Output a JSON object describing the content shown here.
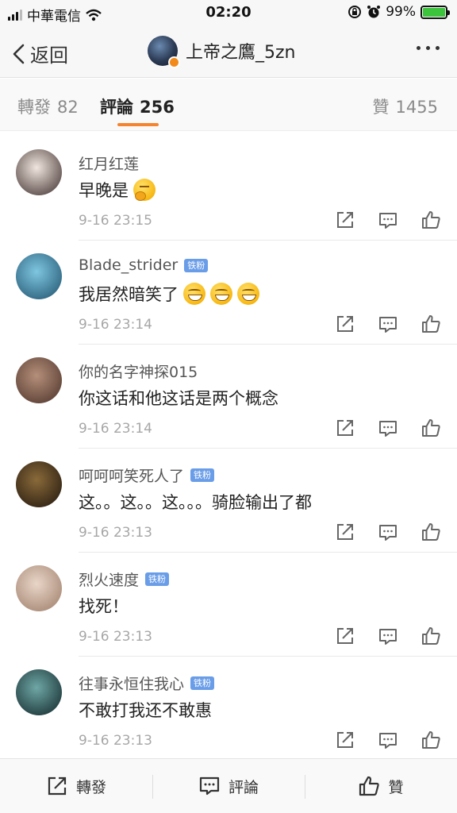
{
  "status_bar": {
    "carrier": "中華電信",
    "time": "02:20",
    "battery": "99%"
  },
  "nav": {
    "back_label": "返回",
    "title": "上帝之鷹_5zn"
  },
  "tabs": [
    {
      "label": "轉發",
      "count": "82"
    },
    {
      "label": "評論",
      "count": "256"
    },
    {
      "label": "贊",
      "count": "1455"
    }
  ],
  "comments": [
    {
      "name": "红月红莲",
      "badge": "",
      "text": "早晚是",
      "emojis": [
        "think"
      ],
      "time": "9-16 23:15",
      "avatar_colors": [
        "#f0e6df",
        "#3a2a28"
      ]
    },
    {
      "name": "Blade_strider",
      "badge": "铁粉",
      "text": "我居然暗笑了",
      "emojis": [
        "grin",
        "grin",
        "grin"
      ],
      "time": "9-16 23:14",
      "avatar_colors": [
        "#7fc6e0",
        "#1d4f6a"
      ]
    },
    {
      "name": "你的名字神探015",
      "badge": "",
      "text": "你这话和他这话是两个概念",
      "emojis": [],
      "time": "9-16 23:14",
      "avatar_colors": [
        "#b58f7a",
        "#4a3128"
      ]
    },
    {
      "name": "呵呵呵笑死人了",
      "badge": "铁粉",
      "text": "这。。这。。这。。。骑脸输出了都",
      "emojis": [],
      "time": "9-16 23:13",
      "avatar_colors": [
        "#8a6a3a",
        "#1e140c"
      ]
    },
    {
      "name": "烈火速度",
      "badge": "铁粉",
      "text": "找死！",
      "emojis": [],
      "time": "9-16 23:13",
      "avatar_colors": [
        "#e9d6c8",
        "#9c7b67"
      ]
    },
    {
      "name": "往事永恒住我心",
      "badge": "铁粉",
      "text": "不敢打我还不敢惠",
      "emojis": [],
      "time": "9-16 23:13",
      "avatar_colors": [
        "#6fa7a6",
        "#0f2326"
      ]
    }
  ],
  "toolbar": {
    "repost_label": "轉發",
    "comment_label": "評論",
    "like_label": "贊"
  },
  "colors": {
    "accent": "#f5842f",
    "badge": "#6a9de8"
  }
}
